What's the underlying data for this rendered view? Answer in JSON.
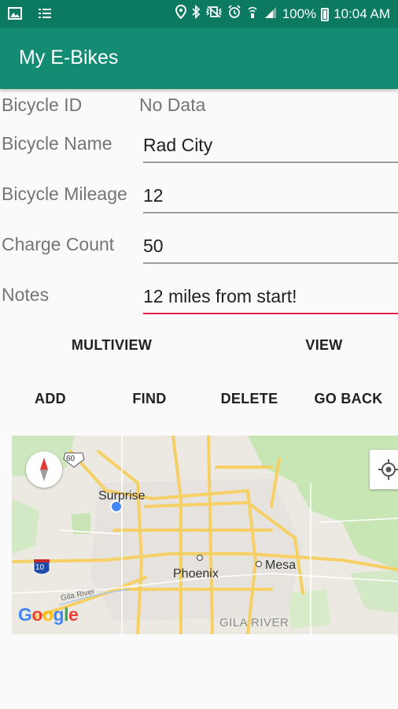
{
  "status_bar": {
    "battery": "100%",
    "time": "10:04 AM"
  },
  "app_bar": {
    "title": "My E-Bikes"
  },
  "form": {
    "bicycle_id": {
      "label": "Bicycle ID",
      "value": "No Data"
    },
    "bicycle_name": {
      "label": "Bicycle Name",
      "value": "Rad City"
    },
    "bicycle_mileage": {
      "label": "Bicycle Mileage",
      "value": "12"
    },
    "charge_count": {
      "label": "Charge Count",
      "value": "50"
    },
    "notes": {
      "label": "Notes",
      "value": "12 miles from start!"
    }
  },
  "buttons": {
    "multiview": "MULTIVIEW",
    "view": "VIEW",
    "add": "ADD",
    "find": "FIND",
    "delete": "DELETE",
    "go_back": "GO BACK"
  },
  "map": {
    "places": {
      "surprise": "Surprise",
      "phoenix": "Phoenix",
      "mesa": "Mesa",
      "gila_river_area": "GILA RIVER",
      "gila_river": "Gila River"
    },
    "shields": {
      "us60": "60",
      "i10": "10"
    },
    "attribution": "Google"
  },
  "colors": {
    "status_bar": "#0b7a61",
    "app_bar": "#148b73",
    "focus_underline": "#e0254a"
  }
}
